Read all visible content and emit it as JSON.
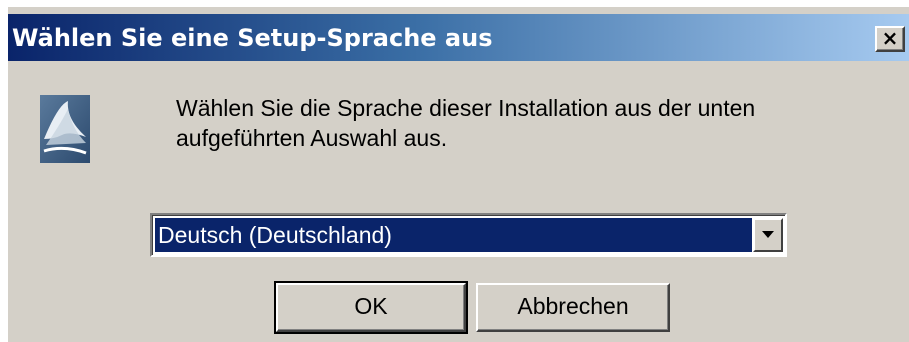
{
  "window": {
    "title": "Wählen Sie eine Setup-Sprache aus",
    "close_label": "×"
  },
  "icon": {
    "name": "setup-icon"
  },
  "message": "Wählen Sie die Sprache dieser Installation aus der unten aufgeführten Auswahl aus.",
  "language_select": {
    "selected": "Deutsch (Deutschland)"
  },
  "buttons": {
    "ok": "OK",
    "cancel": "Abbrechen"
  },
  "colors": {
    "title_bar": "#0a246a",
    "dialog_background": "#d4d0c8",
    "selection": "#0a246a"
  }
}
